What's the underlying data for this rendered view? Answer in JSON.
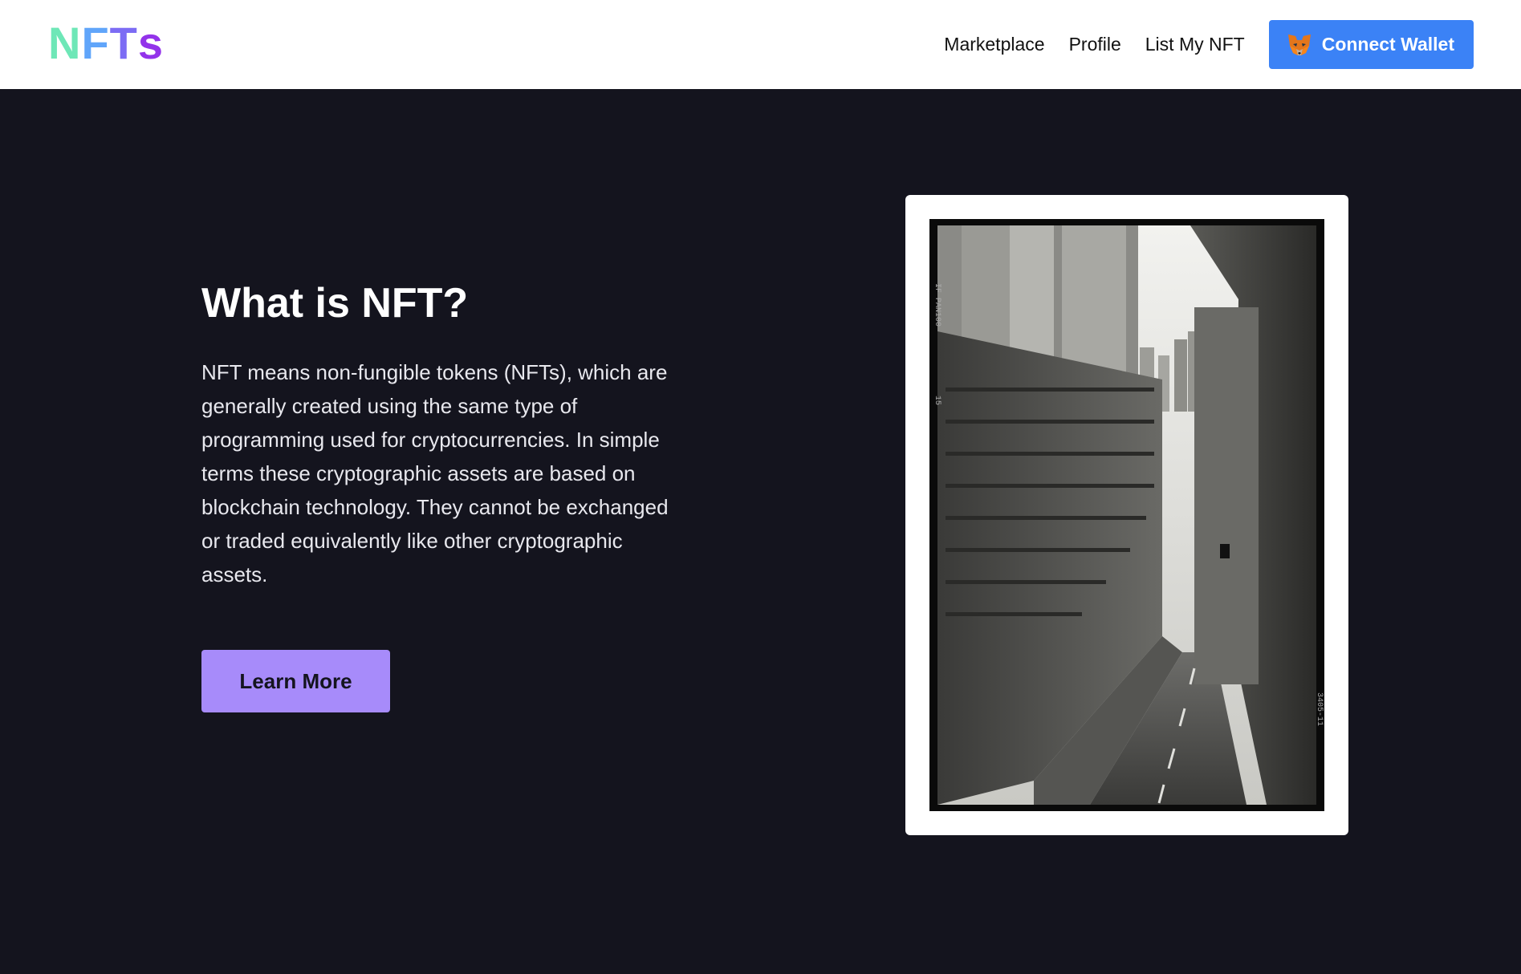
{
  "nav": {
    "logo": [
      "N",
      "F",
      "T",
      "s"
    ],
    "links": [
      "Marketplace",
      "Profile",
      "List My NFT"
    ],
    "connect_label": "Connect Wallet",
    "connect_icon": "metamask-fox-icon"
  },
  "hero": {
    "title": "What is NFT?",
    "description": "NFT means non-fungible tokens (NFTs), which are generally created using the same type of programming used for cryptocurrencies. In simple terms these cryptographic assets are based on blockchain technology. They cannot be exchanged or traded equivalently like other cryptographic assets.",
    "cta_label": "Learn More",
    "image_alt": "black and white photograph of a city street between tall buildings, viewed from above"
  },
  "film_edge_text": [
    "IF PAN100",
    "15",
    "3405-11"
  ],
  "colors": {
    "logo_gradient": [
      "#6ee7b7",
      "#60a5fa",
      "#8b5cf6",
      "#9333ea"
    ],
    "background": "#14141e",
    "connect_button": "#3b82f6",
    "learn_button": "#a78bfa"
  }
}
